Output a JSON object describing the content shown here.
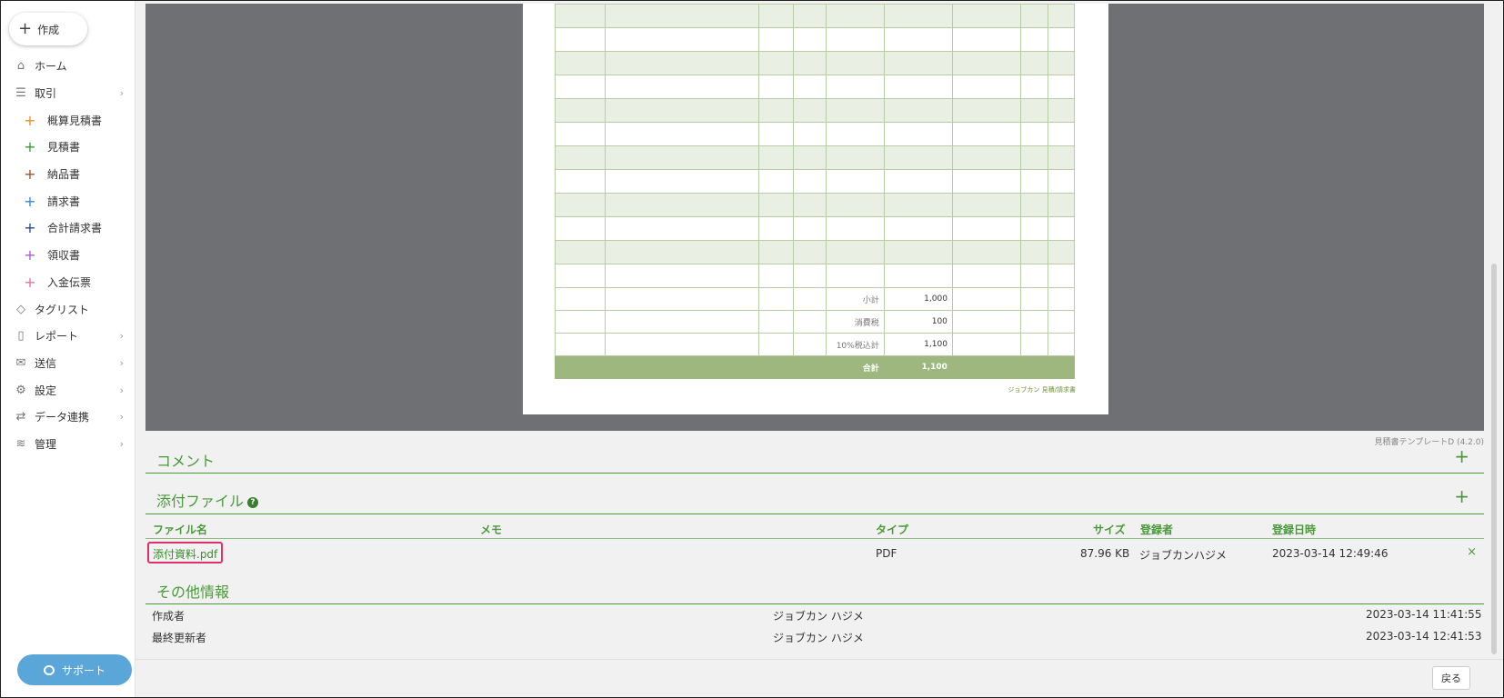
{
  "sidebar": {
    "create_label": "作成",
    "items": [
      {
        "label": "ホーム",
        "icon": "home-icon",
        "chevron": false,
        "sub": false
      },
      {
        "label": "取引",
        "icon": "list-icon",
        "chevron": true,
        "sub": false
      },
      {
        "label": "概算見積書",
        "icon": "plus-icon",
        "color": "#e8912d",
        "sub": true
      },
      {
        "label": "見積書",
        "icon": "plus-icon",
        "color": "#3a9a3a",
        "sub": true
      },
      {
        "label": "納品書",
        "icon": "plus-icon",
        "color": "#a0522d",
        "sub": true
      },
      {
        "label": "請求書",
        "icon": "plus-icon",
        "color": "#3a86d4",
        "sub": true
      },
      {
        "label": "合計請求書",
        "icon": "plus-icon",
        "color": "#2a4a8a",
        "sub": true
      },
      {
        "label": "領収書",
        "icon": "plus-icon",
        "color": "#b05ad0",
        "sub": true
      },
      {
        "label": "入金伝票",
        "icon": "plus-icon",
        "color": "#e07a9a",
        "sub": true
      },
      {
        "label": "タグリスト",
        "icon": "tag-icon",
        "chevron": false,
        "sub": false
      },
      {
        "label": "レポート",
        "icon": "report-icon",
        "chevron": true,
        "sub": false
      },
      {
        "label": "送信",
        "icon": "mail-icon",
        "chevron": true,
        "sub": false
      },
      {
        "label": "設定",
        "icon": "gear-icon",
        "chevron": true,
        "sub": false
      },
      {
        "label": "データ連携",
        "icon": "sync-icon",
        "chevron": true,
        "sub": false
      },
      {
        "label": "管理",
        "icon": "layers-icon",
        "chevron": true,
        "sub": false
      }
    ],
    "support_label": "サポート"
  },
  "preview": {
    "rows": [
      {
        "label": "小計",
        "value": "1,000"
      },
      {
        "label": "消費税",
        "value": "100"
      },
      {
        "label": "10%税込計",
        "value": "1,100"
      }
    ],
    "total_label": "合計",
    "total_value": "1,100",
    "footer_text": "ジョブカン 見積/請求書",
    "template_label": "見積書テンプレートD (4.2.0)"
  },
  "comment": {
    "title": "コメント"
  },
  "attachments": {
    "title": "添付ファイル",
    "headers": {
      "name": "ファイル名",
      "memo": "メモ",
      "type": "タイプ",
      "size": "サイズ",
      "registrant": "登録者",
      "date": "登録日時"
    },
    "file": {
      "name": "添付資料.pdf",
      "memo": "",
      "type": "PDF",
      "size": "87.96 KB",
      "registrant": "ジョブカンハジメ",
      "date": "2023-03-14 12:49:46"
    },
    "delete_symbol": "×"
  },
  "other_info": {
    "title": "その他情報",
    "rows": [
      {
        "label": "作成者",
        "user": "ジョブカン ハジメ",
        "date": "2023-03-14 11:41:55"
      },
      {
        "label": "最終更新者",
        "user": "ジョブカン ハジメ",
        "date": "2023-03-14 12:41:53"
      }
    ]
  },
  "back_label": "戻る"
}
